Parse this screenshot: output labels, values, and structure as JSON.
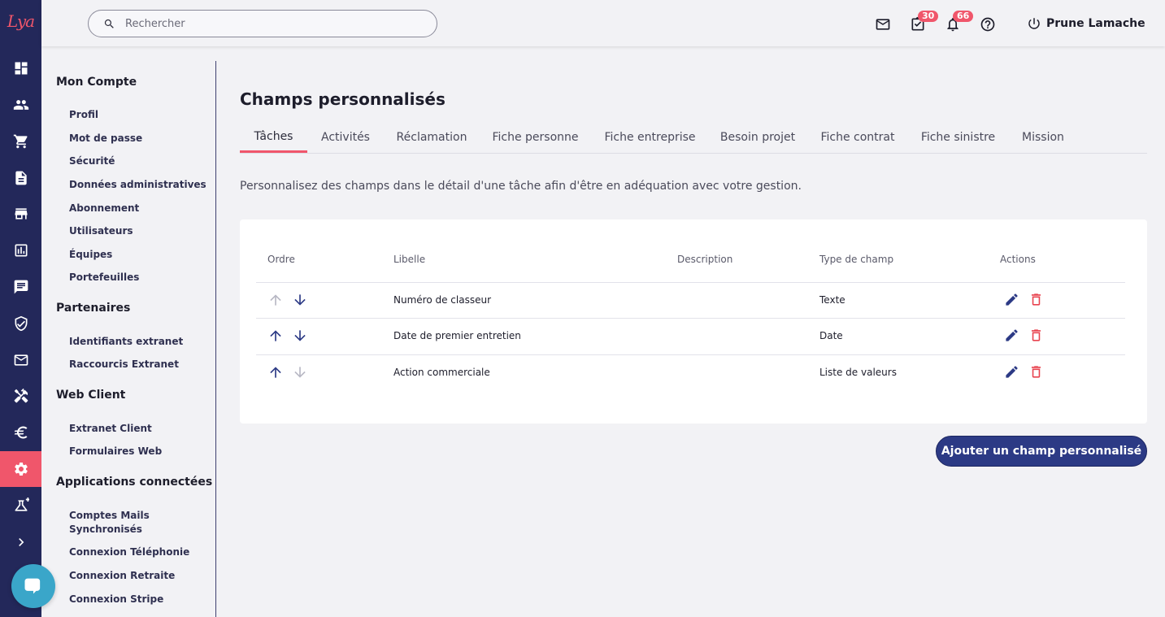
{
  "brand": {
    "logo_text": "Lya",
    "accent": "#f0566b",
    "navy": "#23285a"
  },
  "search": {
    "placeholder": "Rechercher"
  },
  "header": {
    "tasks_badge": "30",
    "notifications_badge": "66",
    "user_name": "Prune Lamache"
  },
  "rail": {
    "icons": [
      "dashboard-icon",
      "people-icon",
      "cart-icon",
      "document-icon",
      "store-icon",
      "analytics-icon",
      "chat-icon",
      "shield-check-icon",
      "mail-icon",
      "tools-icon",
      "euro-icon",
      "gear-icon",
      "flask-icon",
      "chevron-right-icon"
    ],
    "active": "gear-icon"
  },
  "sidemenu": {
    "sections": [
      {
        "title": "Mon Compte",
        "items": [
          "Profil",
          "Mot de passe",
          "Sécurité",
          "Données administratives",
          "Abonnement",
          "Utilisateurs",
          "Équipes",
          "Portefeuilles"
        ]
      },
      {
        "title": "Partenaires",
        "items": [
          "Identifiants extranet",
          "Raccourcis Extranet"
        ]
      },
      {
        "title": "Web Client",
        "items": [
          "Extranet Client",
          "Formulaires Web"
        ]
      },
      {
        "title": "Applications connectées",
        "items": [
          "Comptes Mails Synchronisés",
          "Connexion Téléphonie",
          "Connexion Retraite",
          "Connexion Stripe"
        ]
      }
    ]
  },
  "main": {
    "title": "Champs personnalisés",
    "tabs": [
      "Tâches",
      "Activités",
      "Réclamation",
      "Fiche personne",
      "Fiche entreprise",
      "Besoin projet",
      "Fiche contrat",
      "Fiche sinistre",
      "Mission"
    ],
    "active_tab": "Tâches",
    "intro": "Personnalisez des champs dans le détail d'une tâche afin d'être en adéquation avec votre gestion."
  },
  "table": {
    "headers": {
      "order": "Ordre",
      "label": "Libelle",
      "description": "Description",
      "type": "Type de champ",
      "actions": "Actions"
    },
    "rows": [
      {
        "label": "Numéro de classeur",
        "description": "",
        "type": "Texte",
        "up_enabled": false,
        "down_enabled": true
      },
      {
        "label": "Date de premier entretien",
        "description": "",
        "type": "Date",
        "up_enabled": true,
        "down_enabled": true
      },
      {
        "label": "Action commerciale",
        "description": "",
        "type": "Liste de valeurs",
        "up_enabled": true,
        "down_enabled": false
      }
    ]
  },
  "add_button": "Ajouter un champ personnalisé"
}
